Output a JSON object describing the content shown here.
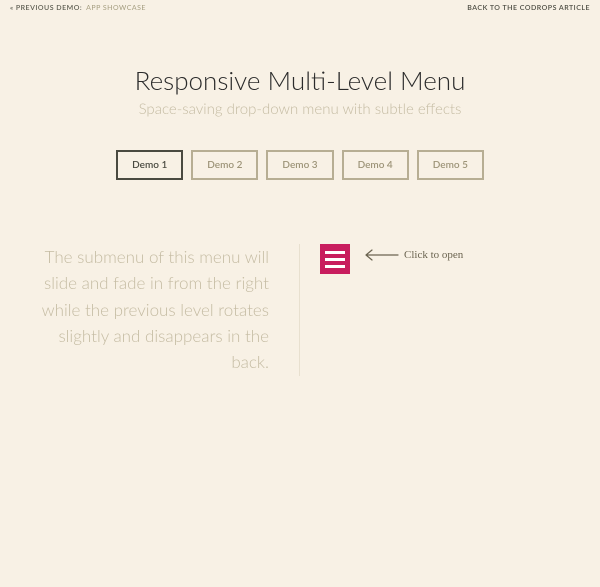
{
  "topbar": {
    "prev_prefix": "« Previous Demo:",
    "prev_demo_name": "App Showcase",
    "back_link": "back to the Codrops article"
  },
  "header": {
    "title": "Responsive Multi-Level Menu",
    "subtitle": "Space-saving drop-down menu with subtle effects"
  },
  "demos": [
    {
      "label": "Demo 1",
      "active": true
    },
    {
      "label": "Demo 2",
      "active": false
    },
    {
      "label": "Demo 3",
      "active": false
    },
    {
      "label": "Demo 4",
      "active": false
    },
    {
      "label": "Demo 5",
      "active": false
    }
  ],
  "main": {
    "description": "The submenu of this menu will slide and fade in from the right while the previous level rotates slightly and disappears in the back.",
    "click_to_open": "Click to open"
  },
  "colors": {
    "background": "#f8f1e5",
    "accent": "#c81d5e",
    "muted_text": "#c4bba2",
    "border_muted": "#b7ae93",
    "border_active": "#4a4a40"
  }
}
